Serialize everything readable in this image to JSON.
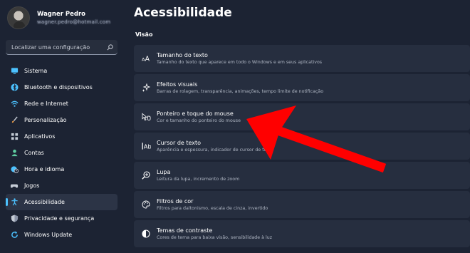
{
  "profile": {
    "name": "Wagner Pedro",
    "email": "wagner.pedro@hotmail.com"
  },
  "search": {
    "placeholder": "Localizar uma configuração"
  },
  "sidebar": {
    "items": [
      {
        "label": "Sistema",
        "icon": "monitor-icon",
        "color": "#4cc2ff"
      },
      {
        "label": "Bluetooth e dispositivos",
        "icon": "bluetooth-icon",
        "color": "#4cc2ff"
      },
      {
        "label": "Rede e Internet",
        "icon": "wifi-icon",
        "color": "#4cc2ff"
      },
      {
        "label": "Personalização",
        "icon": "brush-icon",
        "color": "#f7a349"
      },
      {
        "label": "Aplicativos",
        "icon": "apps-icon",
        "color": "#c5ccd6"
      },
      {
        "label": "Contas",
        "icon": "person-icon",
        "color": "#5fcfa2"
      },
      {
        "label": "Hora e idioma",
        "icon": "globe-clock-icon",
        "color": "#4cc2ff"
      },
      {
        "label": "Jogos",
        "icon": "gamepad-icon",
        "color": "#c5ccd6"
      },
      {
        "label": "Acessibilidade",
        "icon": "accessibility-icon",
        "color": "#4cc2ff",
        "active": true
      },
      {
        "label": "Privacidade e segurança",
        "icon": "shield-icon",
        "color": "#c5ccd6"
      },
      {
        "label": "Windows Update",
        "icon": "update-icon",
        "color": "#4cc2ff"
      }
    ]
  },
  "main": {
    "title": "Acessibilidade",
    "section": "Visão",
    "cards": [
      {
        "title": "Tamanho do texto",
        "desc": "Tamanho do texto que aparece em todo o Windows e em seus aplicativos",
        "icon": "text-size-icon"
      },
      {
        "title": "Efeitos visuais",
        "desc": "Barras de rolagem, transparência, animações, tempo limite de notificação",
        "icon": "sparkle-icon"
      },
      {
        "title": "Ponteiro e toque do mouse",
        "desc": "Cor e tamanho do ponteiro do mouse",
        "icon": "mouse-pointer-icon"
      },
      {
        "title": "Cursor de texto",
        "desc": "Aparência e espessura, indicador de cursor de texto",
        "icon": "text-cursor-icon"
      },
      {
        "title": "Lupa",
        "desc": "Leitura da lupa, incremento de zoom",
        "icon": "magnifier-icon"
      },
      {
        "title": "Filtros de cor",
        "desc": "Filtros para daltonismo, escala de cinza, invertido",
        "icon": "palette-icon"
      },
      {
        "title": "Temas de contraste",
        "desc": "Cores de tema para baixa visão, sensibilidade à luz",
        "icon": "contrast-icon"
      }
    ]
  },
  "colors": {
    "accent": "#4cc2ff",
    "annotation_arrow": "#ff0000"
  }
}
